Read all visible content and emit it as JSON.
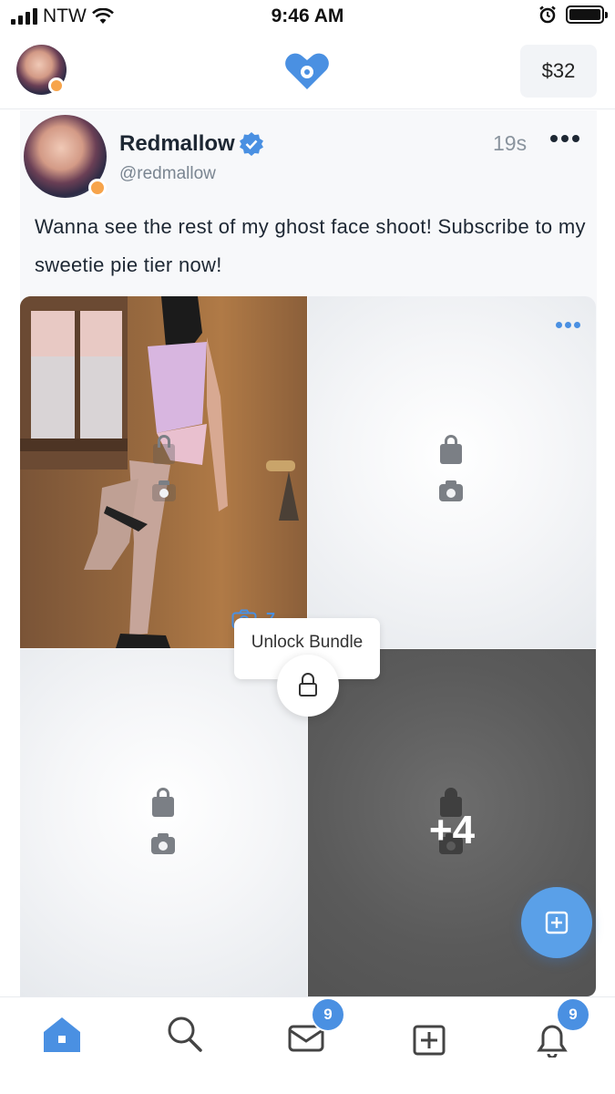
{
  "status_bar": {
    "carrier": "NTW",
    "time": "9:46 AM"
  },
  "header": {
    "balance": "$32",
    "logo_icon": "heart-logo-icon"
  },
  "post": {
    "author_name": "Redmallow",
    "author_handle": "@redmallow",
    "time_ago": "19s",
    "caption": "Wanna see the rest of my ghost face shoot! Subscribe to my sweetie pie tier now!",
    "media_count": "7",
    "unlock_label": "Unlock Bundle",
    "more_count": "+4"
  },
  "tabbar": {
    "items": [
      "home",
      "search",
      "messages",
      "create",
      "notifications"
    ],
    "messages_badge": "9",
    "notifications_badge": "9"
  },
  "colors": {
    "accent": "#4a90e2",
    "online": "#f7a44b",
    "dark_tile": "#5a5a5a"
  }
}
